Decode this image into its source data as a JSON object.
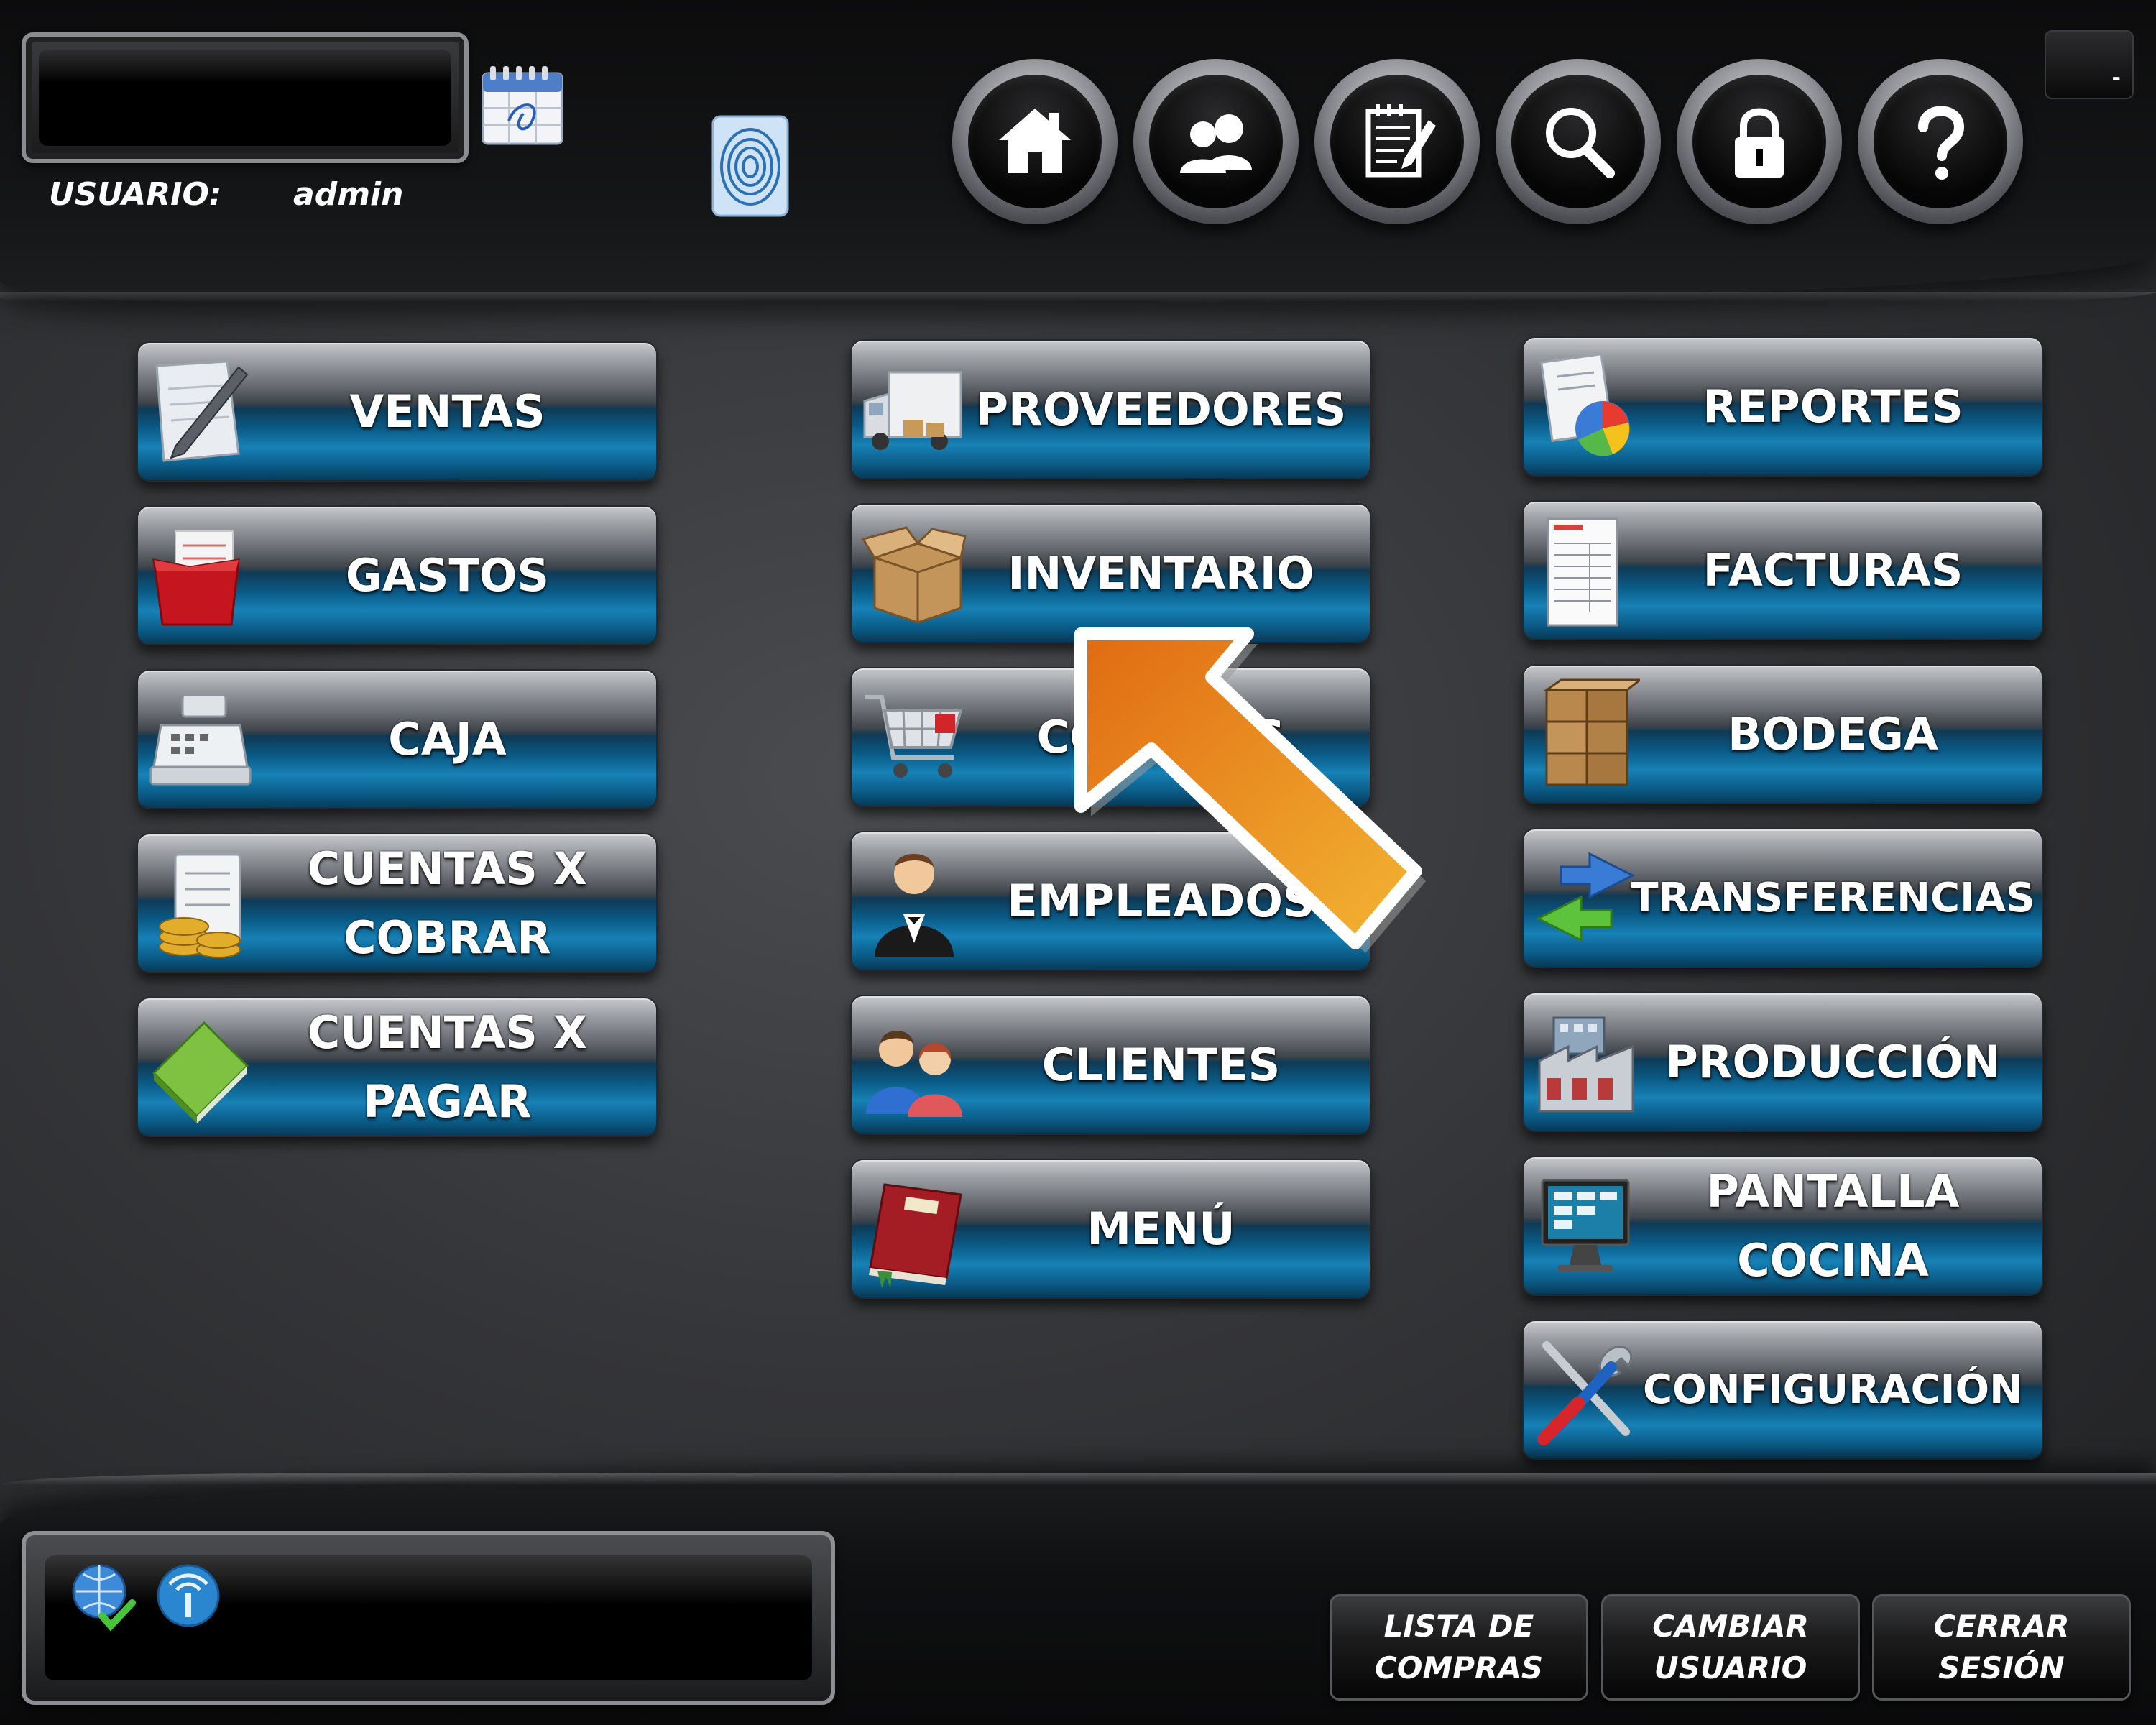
{
  "header": {
    "user_label": "USUARIO:",
    "user_value": "admin",
    "minimize_label": "-"
  },
  "nav_buttons": [
    {
      "icon": "home-icon"
    },
    {
      "icon": "users-icon"
    },
    {
      "icon": "notes-icon"
    },
    {
      "icon": "search-icon"
    },
    {
      "icon": "lock-icon"
    },
    {
      "icon": "help-icon"
    }
  ],
  "menu": {
    "col1": [
      {
        "label": "VENTAS",
        "icon": "pen-document-icon"
      },
      {
        "label": "GASTOS",
        "icon": "red-folder-icon"
      },
      {
        "label": "CAJA",
        "icon": "cash-register-icon"
      },
      {
        "label": "CUENTAS X\nCOBRAR",
        "icon": "coins-receipt-icon"
      },
      {
        "label": "CUENTAS X\nPAGAR",
        "icon": "green-book-icon"
      }
    ],
    "col2": [
      {
        "label": "PROVEEDORES",
        "icon": "delivery-truck-icon"
      },
      {
        "label": "INVENTARIO",
        "icon": "open-box-icon"
      },
      {
        "label": "COMPRAS",
        "icon": "shopping-cart-icon"
      },
      {
        "label": "EMPLEADOS",
        "icon": "waiter-icon"
      },
      {
        "label": "CLIENTES",
        "icon": "people-icon"
      },
      {
        "label": "MENÚ",
        "icon": "menu-book-icon"
      }
    ],
    "col3": [
      {
        "label": "REPORTES",
        "icon": "report-chart-icon"
      },
      {
        "label": "FACTURAS",
        "icon": "invoice-icon"
      },
      {
        "label": "BODEGA",
        "icon": "boxes-icon"
      },
      {
        "label": "TRANSFERENCIAS",
        "icon": "transfer-arrows-icon"
      },
      {
        "label": "PRODUCCIÓN",
        "icon": "factory-icon"
      },
      {
        "label": "PANTALLA\nCOCINA",
        "icon": "monitor-icon"
      },
      {
        "label": "CONFIGURACIÓN",
        "icon": "tools-icon"
      }
    ]
  },
  "footer": {
    "buttons": [
      {
        "label": "LISTA DE\nCOMPRAS"
      },
      {
        "label": "CAMBIAR\nUSUARIO"
      },
      {
        "label": "CERRAR\nSESIÓN"
      }
    ],
    "status_icons": [
      "globe-check-icon",
      "signal-icon"
    ]
  },
  "colors": {
    "button_blue": "#1781b6",
    "arrow_orange": "#ef9a2a",
    "background": "#343538"
  }
}
